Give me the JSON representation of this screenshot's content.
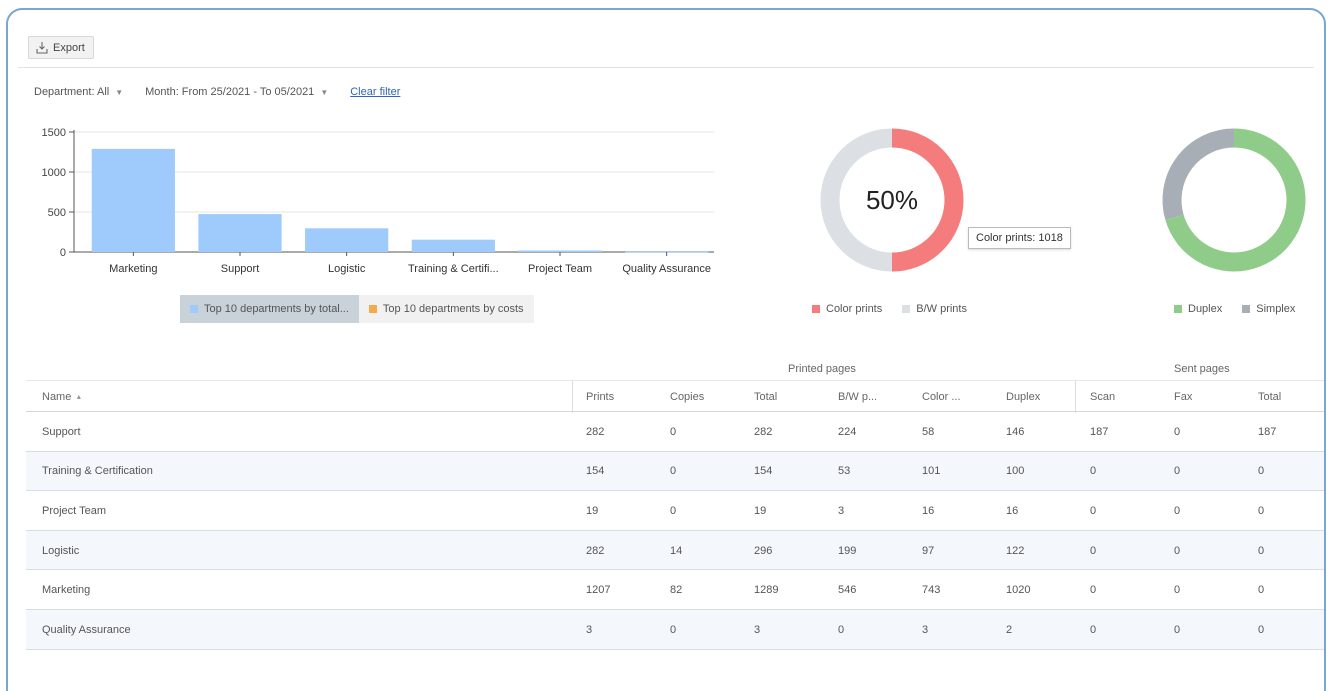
{
  "toolbar": {
    "export_label": "Export"
  },
  "filters": {
    "department": "Department: All",
    "month": "Month: From 25/2021 - To 05/2021",
    "clear": "Clear filter"
  },
  "chart_data": [
    {
      "type": "bar",
      "categories": [
        "Marketing",
        "Support",
        "Logistic",
        "Training & Certifi...",
        "Project Team",
        "Quality Assurance"
      ],
      "values": [
        1289,
        474,
        296,
        154,
        19,
        3
      ],
      "ylim": [
        0,
        1500
      ],
      "yticks": [
        0,
        500,
        1000,
        1500
      ],
      "grid": true,
      "color": "#9ecbfb"
    },
    {
      "type": "pie",
      "donut": true,
      "labels": [
        "Color prints",
        "B/W prints"
      ],
      "values": [
        1018,
        1018
      ],
      "colors": [
        "#f47c7c",
        "#dcdfe3"
      ],
      "center_text": "50%",
      "tooltip": "Color prints: 1018"
    },
    {
      "type": "pie",
      "donut": true,
      "labels": [
        "Duplex",
        "Simplex"
      ],
      "values": [
        1306,
        547
      ],
      "colors": [
        "#8fcc8a",
        "#a8aeb6"
      ]
    }
  ],
  "legend_tabs": [
    {
      "label": "Top 10 departments by total...",
      "color": "#9ecbfb",
      "active": true
    },
    {
      "label": "Top 10 departments by costs",
      "color": "#f7a94b",
      "active": false
    }
  ],
  "pie1_legend": [
    {
      "label": "Color prints",
      "color": "#f47c7c"
    },
    {
      "label": "B/W prints",
      "color": "#dcdfe3"
    }
  ],
  "pie2_legend": [
    {
      "label": "Duplex",
      "color": "#8fcc8a"
    },
    {
      "label": "Simplex",
      "color": "#a8aeb6"
    }
  ],
  "table": {
    "group_headers": {
      "printed": "Printed pages",
      "sent": "Sent pages"
    },
    "name_header": "Name",
    "sort_icon": "▲",
    "columns": [
      "Prints",
      "Copies",
      "Total",
      "B/W p...",
      "Color ...",
      "Duplex",
      "Scan",
      "Fax",
      "Total"
    ],
    "rows": [
      {
        "name": "Support",
        "cells": [
          "282",
          "0",
          "282",
          "224",
          "58",
          "146",
          "187",
          "0",
          "187"
        ]
      },
      {
        "name": "Training & Certification",
        "cells": [
          "154",
          "0",
          "154",
          "53",
          "101",
          "100",
          "0",
          "0",
          "0"
        ]
      },
      {
        "name": "Project Team",
        "cells": [
          "19",
          "0",
          "19",
          "3",
          "16",
          "16",
          "0",
          "0",
          "0"
        ]
      },
      {
        "name": "Logistic",
        "cells": [
          "282",
          "14",
          "296",
          "199",
          "97",
          "122",
          "0",
          "0",
          "0"
        ]
      },
      {
        "name": "Marketing",
        "cells": [
          "1207",
          "82",
          "1289",
          "546",
          "743",
          "1020",
          "0",
          "0",
          "0"
        ]
      },
      {
        "name": "Quality Assurance",
        "cells": [
          "3",
          "0",
          "3",
          "0",
          "3",
          "2",
          "0",
          "0",
          "0"
        ]
      }
    ]
  }
}
